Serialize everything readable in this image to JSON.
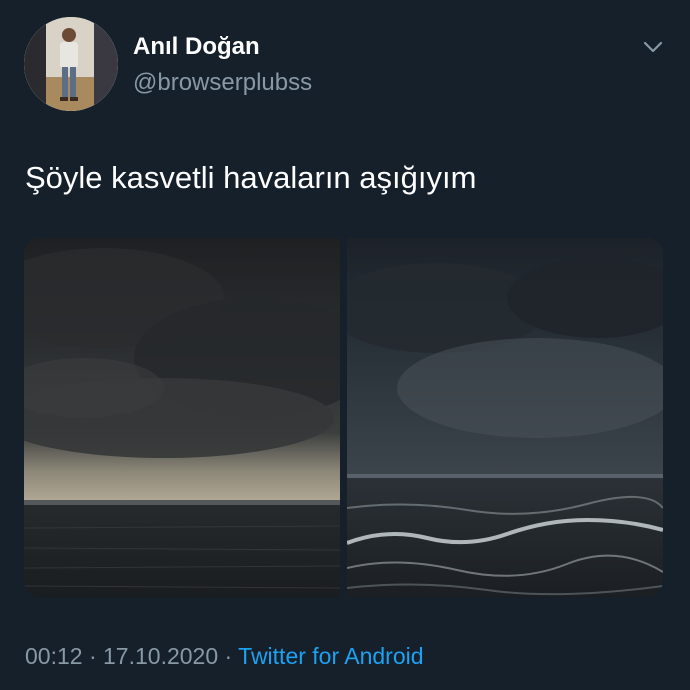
{
  "user": {
    "display_name": "Anıl Doğan",
    "handle": "@browserplubss",
    "avatar_icon": "profile-photo"
  },
  "tweet": {
    "text": "Şöyle kasvetli havaların aşığıyım"
  },
  "media": [
    {
      "icon": "stormy-sky-over-sea-photo"
    },
    {
      "icon": "dark-clouds-rough-waves-photo"
    }
  ],
  "meta": {
    "time": "00:12",
    "separator": " · ",
    "date": "17.10.2020",
    "source": "Twitter for Android"
  },
  "menu_icon": "chevron-down-icon",
  "colors": {
    "background": "#15202b",
    "primary_text": "#ffffff",
    "secondary_text": "#8899a6",
    "link": "#1da1f2"
  }
}
